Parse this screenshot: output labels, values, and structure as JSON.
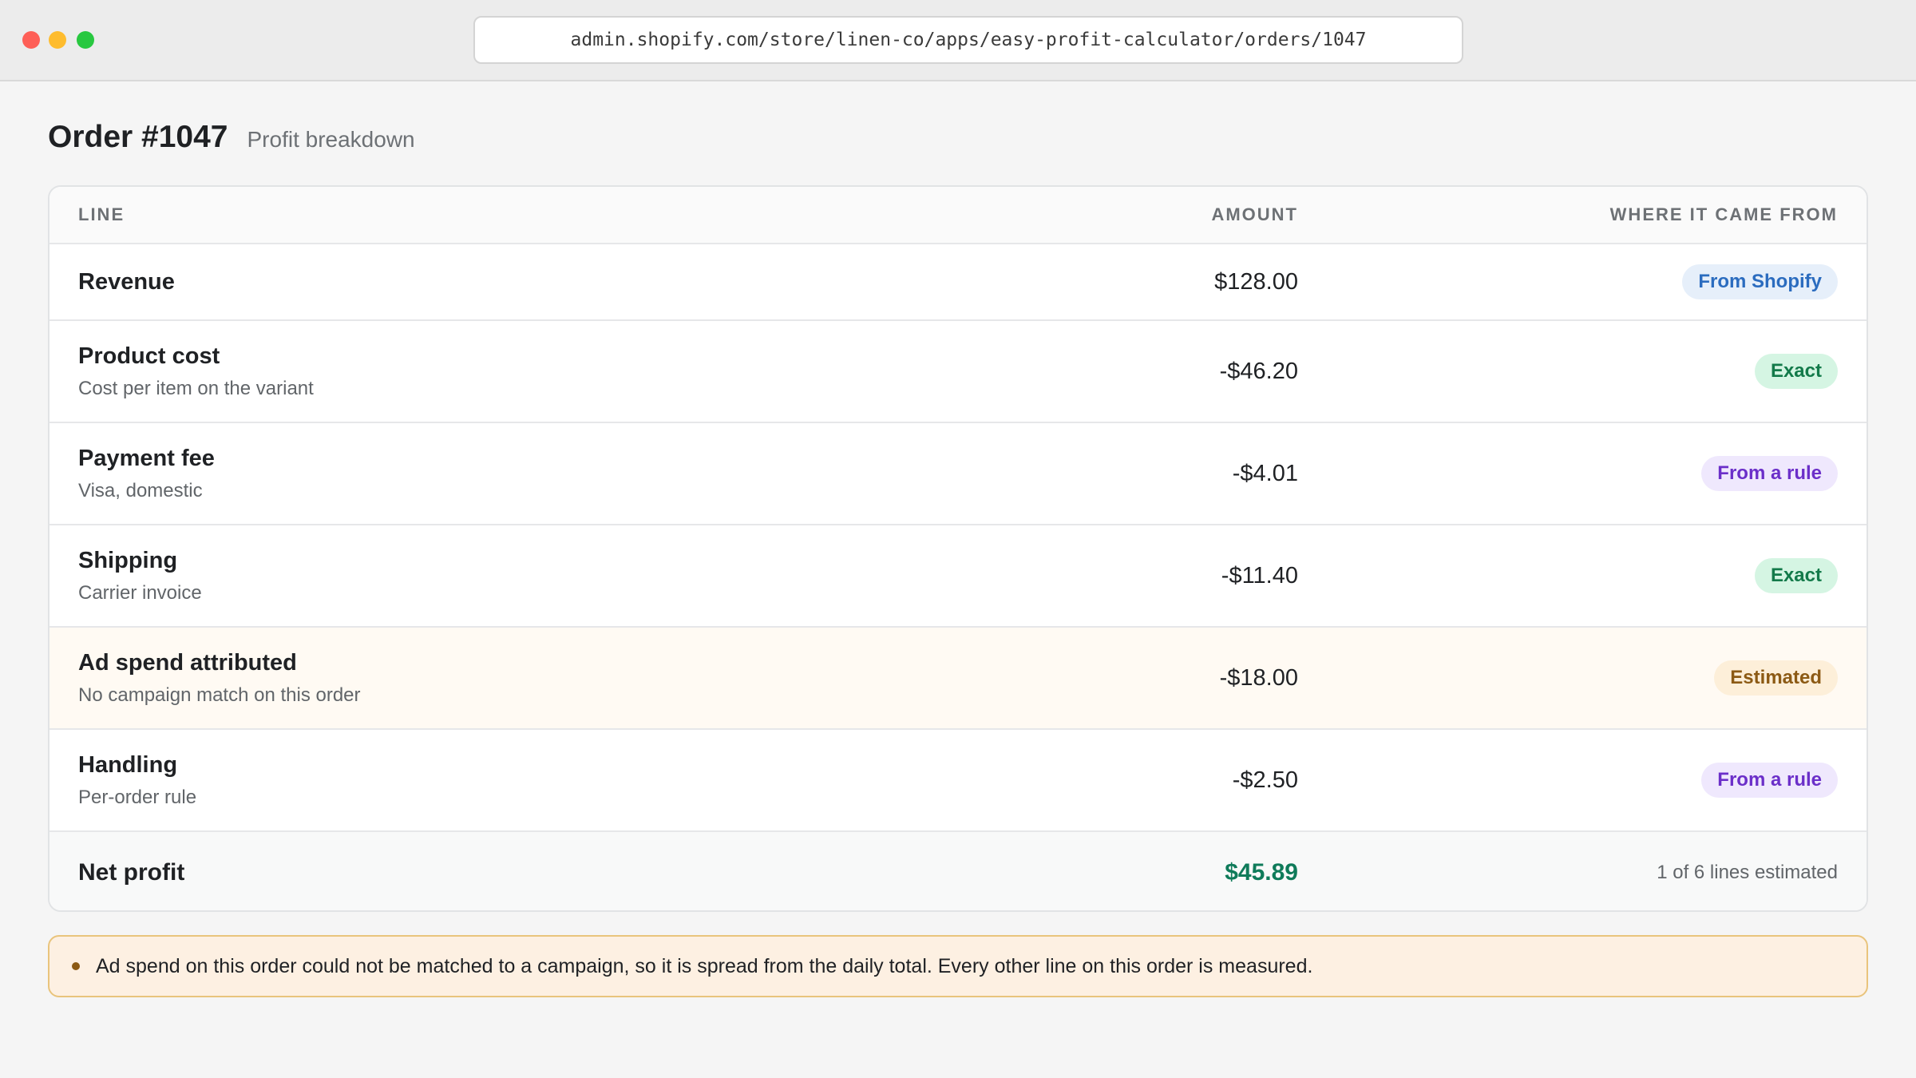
{
  "browser": {
    "url": "admin.shopify.com/store/linen-co/apps/easy-profit-calculator/orders/1047"
  },
  "page": {
    "title": "Order #1047",
    "subtitle": "Profit breakdown"
  },
  "table": {
    "headers": {
      "line": "LINE",
      "amount": "AMOUNT",
      "source": "WHERE IT CAME FROM"
    },
    "rows": [
      {
        "name": "Revenue",
        "description": "",
        "amount": "$128.00",
        "source": "From Shopify",
        "source_kind": "shopify"
      },
      {
        "name": "Product cost",
        "description": "Cost per item on the variant",
        "amount": "-$46.20",
        "source": "Exact",
        "source_kind": "exact"
      },
      {
        "name": "Payment fee",
        "description": "Visa, domestic",
        "amount": "-$4.01",
        "source": "From a rule",
        "source_kind": "rule"
      },
      {
        "name": "Shipping",
        "description": "Carrier invoice",
        "amount": "-$11.40",
        "source": "Exact",
        "source_kind": "exact"
      },
      {
        "name": "Ad spend attributed",
        "description": "No campaign match on this order",
        "amount": "-$18.00",
        "source": "Estimated",
        "source_kind": "estimated"
      },
      {
        "name": "Handling",
        "description": "Per-order rule",
        "amount": "-$2.50",
        "source": "From a rule",
        "source_kind": "rule"
      }
    ],
    "total": {
      "label": "Net profit",
      "amount": "$45.89",
      "note": "1 of 6 lines estimated"
    }
  },
  "notice": {
    "text": "Ad spend on this order could not be matched to a campaign, so it is spread from the daily total. Every other line on this order is measured."
  },
  "colors": {
    "profit": "#0f7b5a",
    "shopify_badge": "#2b6cbf",
    "exact_badge": "#137a4a",
    "rule_badge": "#6b2fc9",
    "estimated_badge": "#8c5a14"
  }
}
